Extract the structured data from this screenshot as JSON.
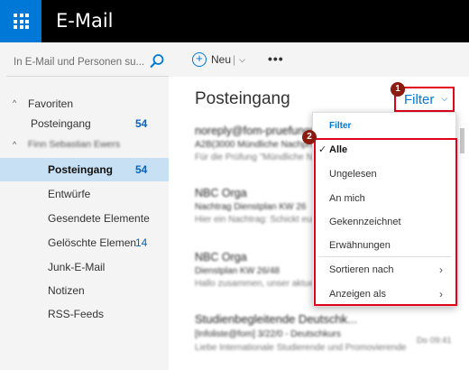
{
  "app": {
    "title": "E-Mail"
  },
  "search": {
    "placeholder": "In E-Mail und Personen su..."
  },
  "nav": {
    "favorites": {
      "label": "Favoriten",
      "items": [
        {
          "label": "Posteingang",
          "count": "54"
        }
      ]
    },
    "account": {
      "label": "Finn Sebastian Ewers",
      "items": [
        {
          "label": "Posteingang",
          "count": "54"
        },
        {
          "label": "Entwürfe",
          "count": ""
        },
        {
          "label": "Gesendete Elemente",
          "count": ""
        },
        {
          "label": "Gelöschte Elemen",
          "count": "14"
        },
        {
          "label": "Junk-E-Mail",
          "count": ""
        },
        {
          "label": "Notizen",
          "count": ""
        },
        {
          "label": "RSS-Feeds",
          "count": ""
        }
      ]
    }
  },
  "toolbar": {
    "new_label": "Neu",
    "separator": "|"
  },
  "inbox": {
    "title": "Posteingang",
    "filter_label": "Filter"
  },
  "markers": {
    "one": "1",
    "two": "2"
  },
  "messages": [
    {
      "sender": "noreply@fom-pruefungsamt",
      "subject": "A2B(3000 Mündliche Nachprüfung",
      "preview": "Für die Prüfung \"Mündliche Nachprüfung\""
    },
    {
      "sender": "NBC Orga",
      "subject": "Nachtrag Dienstplan KW 26",
      "preview": "Hier ein Nachtrag: Schickt euch bitte"
    },
    {
      "sender": "NBC Orga",
      "subject": "Dienstplan KW 26/48",
      "preview": "Hallo zusammen, unser aktueller Plan"
    },
    {
      "sender": "Studienbegleitende Deutschk...",
      "subject": "[Infoliste@fom] 3/22/0 - Deutschkurs",
      "preview": "Liebe Internationale Studierende und Promovierende",
      "time": "Do 09:41"
    }
  ],
  "dropdown": {
    "header": "Filter",
    "items": [
      {
        "label": "Alle",
        "checked": true
      },
      {
        "label": "Ungelesen"
      },
      {
        "label": "An mich"
      },
      {
        "label": "Gekennzeichnet"
      },
      {
        "label": "Erwähnungen"
      },
      {
        "label": "Sortieren nach",
        "submenu": true
      },
      {
        "label": "Anzeigen als",
        "submenu": true
      }
    ]
  },
  "colors": {
    "accent": "#0078d7",
    "highlight": "#e3001b",
    "selected": "#c7e0f4",
    "marker": "#8b1a10"
  }
}
